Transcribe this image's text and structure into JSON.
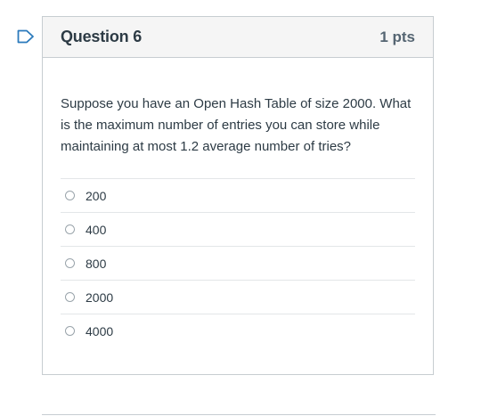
{
  "question": {
    "title": "Question 6",
    "points": "1 pts",
    "text": "Suppose you have an Open Hash Table of size 2000. What is the maximum number of entries you can store while maintaining at most 1.2 average number of tries?",
    "answers": [
      {
        "label": "200"
      },
      {
        "label": "400"
      },
      {
        "label": "800"
      },
      {
        "label": "2000"
      },
      {
        "label": "4000"
      }
    ]
  },
  "colors": {
    "accent": "#2b7abc",
    "header_bg": "#f5f5f5",
    "border": "#c7cdd1",
    "text": "#2d3b45"
  },
  "icons": {
    "flag": "flag-icon"
  }
}
